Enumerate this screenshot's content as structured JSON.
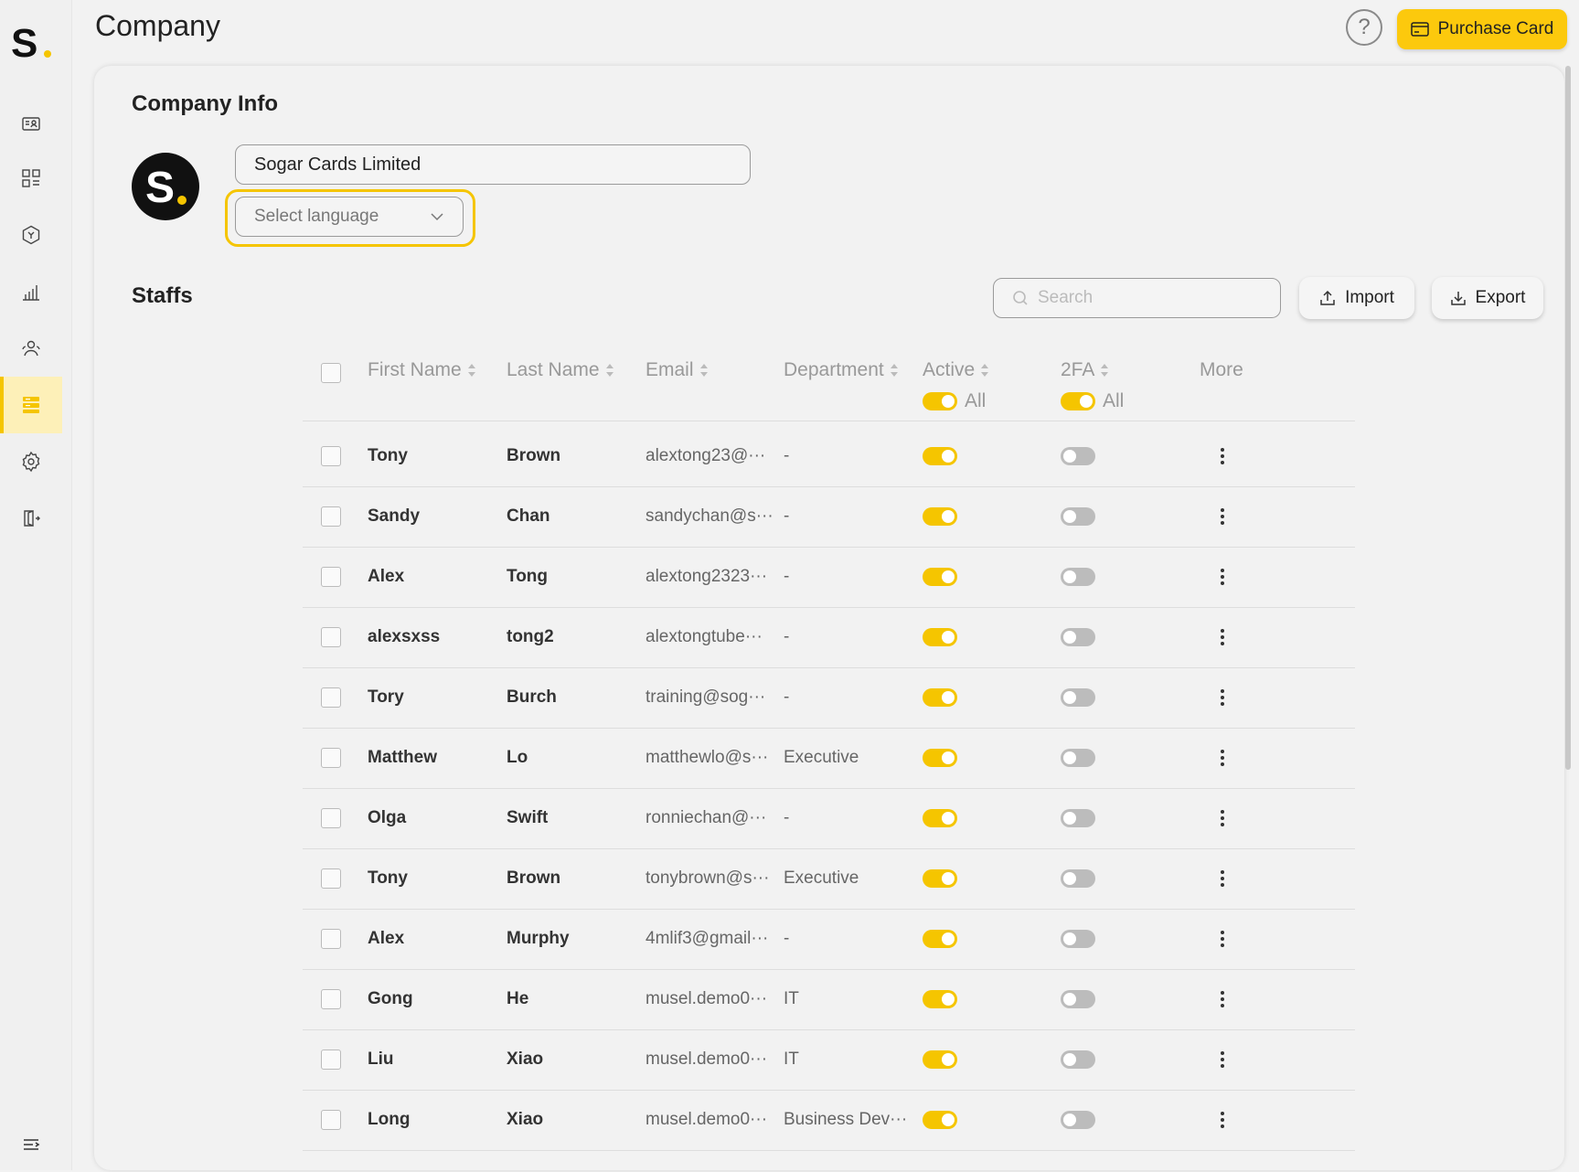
{
  "app": {
    "brand_letter": "S"
  },
  "header": {
    "title": "Company",
    "help_label": "?",
    "purchase_label": "Purchase Card"
  },
  "sidebar": {
    "items": [
      {
        "icon": "contacts-icon",
        "active": false
      },
      {
        "icon": "dashboard-icon",
        "active": false
      },
      {
        "icon": "cube-icon",
        "active": false
      },
      {
        "icon": "chart-icon",
        "active": false
      },
      {
        "icon": "users-icon",
        "active": false
      },
      {
        "icon": "company-icon",
        "active": true
      },
      {
        "icon": "settings-icon",
        "active": false
      },
      {
        "icon": "logout-icon",
        "active": false
      }
    ],
    "collapse_icon": "collapse-menu-icon"
  },
  "company_info": {
    "title": "Company Info",
    "company_name": "Sogar Cards Limited",
    "language_placeholder": "Select language"
  },
  "staffs": {
    "title": "Staffs",
    "search_placeholder": "Search",
    "import_label": "Import",
    "export_label": "Export",
    "columns": {
      "first_name": "First Name",
      "last_name": "Last Name",
      "email": "Email",
      "department": "Department",
      "active": "Active",
      "twofa": "2FA",
      "more": "More"
    },
    "filters": {
      "active_all": "All",
      "twofa_all": "All"
    },
    "rows": [
      {
        "first": "Tony",
        "last": "Brown",
        "email": "alextong23@···",
        "dept": "-",
        "active": true,
        "twofa": false
      },
      {
        "first": "Sandy",
        "last": "Chan",
        "email": "sandychan@s···",
        "dept": "-",
        "active": true,
        "twofa": false
      },
      {
        "first": "Alex",
        "last": "Tong",
        "email": "alextong2323···",
        "dept": "-",
        "active": true,
        "twofa": false
      },
      {
        "first": "alexsxss",
        "last": "tong2",
        "email": "alextongtube···",
        "dept": "-",
        "active": true,
        "twofa": false
      },
      {
        "first": "Tory",
        "last": "Burch",
        "email": "training@sog···",
        "dept": "-",
        "active": true,
        "twofa": false
      },
      {
        "first": "Matthew",
        "last": "Lo",
        "email": "matthewlo@s···",
        "dept": "Executive",
        "active": true,
        "twofa": false
      },
      {
        "first": "Olga",
        "last": "Swift",
        "email": "ronniechan@···",
        "dept": "-",
        "active": true,
        "twofa": false
      },
      {
        "first": "Tony",
        "last": "Brown",
        "email": "tonybrown@s···",
        "dept": "Executive",
        "active": true,
        "twofa": false
      },
      {
        "first": "Alex",
        "last": "Murphy",
        "email": "4mlif3@gmail···",
        "dept": "-",
        "active": true,
        "twofa": false
      },
      {
        "first": "Gong",
        "last": "He",
        "email": "musel.demo0···",
        "dept": "IT",
        "active": true,
        "twofa": false
      },
      {
        "first": "Liu",
        "last": "Xiao",
        "email": "musel.demo0···",
        "dept": "IT",
        "active": true,
        "twofa": false
      },
      {
        "first": "Long",
        "last": "Xiao",
        "email": "musel.demo0···",
        "dept": "Business Dev···",
        "active": true,
        "twofa": false
      }
    ]
  },
  "colors": {
    "accent": "#fcc90d",
    "toggle_on": "#f5c500",
    "toggle_off": "#bcbcbc"
  }
}
